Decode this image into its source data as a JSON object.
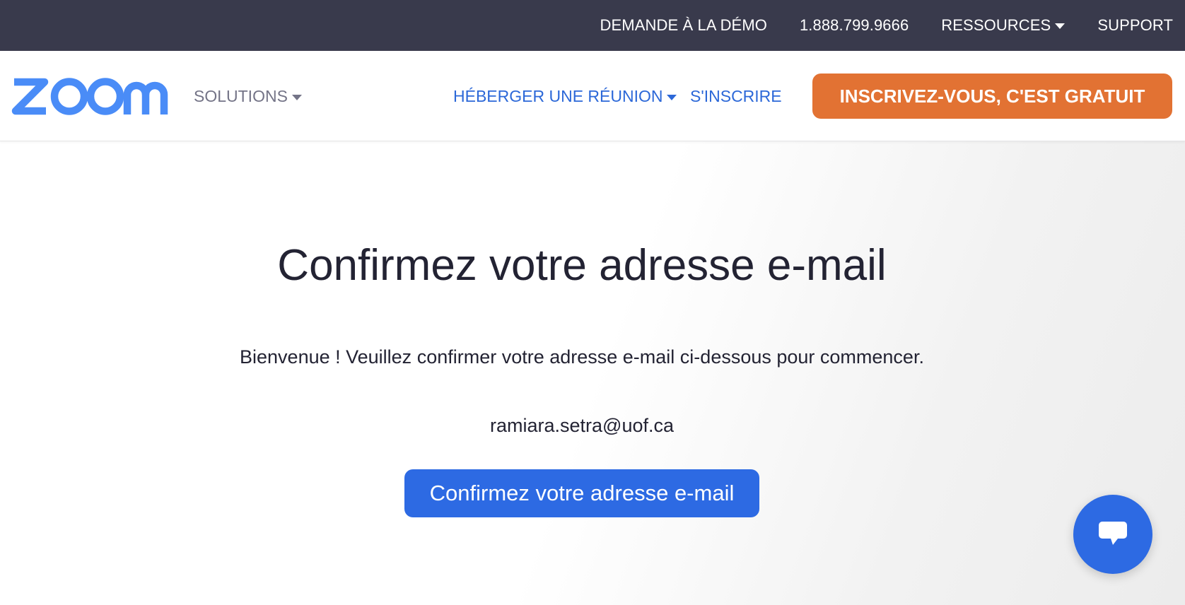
{
  "topbar": {
    "items": [
      {
        "label": "DEMANDE À LA DÉMO"
      },
      {
        "label": "1.888.799.9666"
      },
      {
        "label": "RESSOURCES"
      },
      {
        "label": "SUPPORT"
      }
    ]
  },
  "navbar": {
    "logo_text": "zoom",
    "solutions_label": "SOLUTIONS",
    "host_label": "HÉBERGER UNE RÉUNION",
    "signin_label": "S'INSCRIRE",
    "cta_label": "INSCRIVEZ-VOUS, C'EST GRATUIT"
  },
  "main": {
    "title": "Confirmez votre adresse e-mail",
    "intro": "Bienvenue ! Veuillez confirmer votre adresse e-mail ci-dessous pour commencer.",
    "email": "ramiara.setra@uof.ca",
    "confirm_label": "Confirmez votre adresse e-mail"
  },
  "icons": {
    "logo": "zoom-logo",
    "chat": "chat-bubble-icon",
    "dropdown": "chevron-down-icon"
  },
  "colors": {
    "topbar_bg": "#393a4c",
    "brand_blue": "#2d6ae3",
    "logo_blue": "#4a8cf7",
    "cta_orange": "#e27233",
    "text_dark": "#232333",
    "nav_gray": "#747487"
  }
}
